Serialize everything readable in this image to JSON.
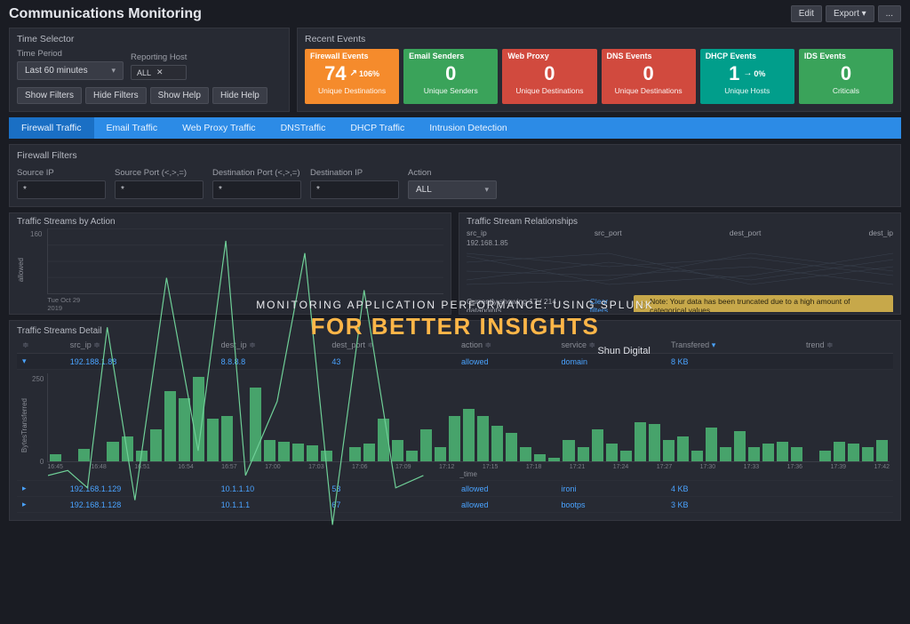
{
  "header": {
    "title": "Communications Monitoring",
    "edit": "Edit",
    "export": "Export ▾",
    "more": "..."
  },
  "time_selector": {
    "panel_label": "Time Selector",
    "time_period_label": "Time Period",
    "time_period_value": "Last 60 minutes",
    "reporting_host_label": "Reporting Host",
    "reporting_host_value": "ALL",
    "buttons": {
      "show_filters": "Show Filters",
      "hide_filters": "Hide Filters",
      "show_help": "Show Help",
      "hide_help": "Hide Help"
    }
  },
  "recent_events": {
    "panel_label": "Recent Events",
    "cards": [
      {
        "title": "Firewall Events",
        "value": "74",
        "badge": "106%",
        "arrow": "up",
        "sub": "Unique Destinations",
        "color": "c-orange"
      },
      {
        "title": "Email Senders",
        "value": "0",
        "badge": "",
        "arrow": "",
        "sub": "Unique Senders",
        "color": "c-green"
      },
      {
        "title": "Web Proxy",
        "value": "0",
        "badge": "",
        "arrow": "",
        "sub": "Unique Destinations",
        "color": "c-red"
      },
      {
        "title": "DNS Events",
        "value": "0",
        "badge": "",
        "arrow": "",
        "sub": "Unique Destinations",
        "color": "c-red"
      },
      {
        "title": "DHCP Events",
        "value": "1",
        "badge": "0%",
        "arrow": "right",
        "sub": "Unique Hosts",
        "color": "c-teal"
      },
      {
        "title": "IDS Events",
        "value": "0",
        "badge": "",
        "arrow": "",
        "sub": "Criticals",
        "color": "c-green"
      }
    ]
  },
  "tabs": [
    "Firewall Traffic",
    "Email Traffic",
    "Web Proxy Traffic",
    "DNSTraffic",
    "DHCP Traffic",
    "Intrusion Detection"
  ],
  "active_tab": 0,
  "firewall_filters": {
    "label": "Firewall Filters",
    "fields": [
      {
        "label": "Source IP",
        "value": "*"
      },
      {
        "label": "Source Port (<,>,=)",
        "value": "*"
      },
      {
        "label": "Destination Port (<,>,=)",
        "value": "*"
      },
      {
        "label": "Destination IP",
        "value": "*"
      }
    ],
    "action_label": "Action",
    "action_value": "ALL"
  },
  "streams_by_action": {
    "title": "Traffic Streams by Action",
    "ylabel": "allowed",
    "ymax": "160",
    "ymin": "",
    "xticks": [
      "Tue Oct 29",
      "2019"
    ],
    "chart_data": {
      "type": "line",
      "series": [
        {
          "name": "allowed",
          "points": [
            [
              0,
              60
            ],
            [
              5,
              62
            ],
            [
              10,
              55
            ],
            [
              15,
              120
            ],
            [
              22,
              50
            ],
            [
              30,
              140
            ],
            [
              38,
              70
            ],
            [
              45,
              155
            ],
            [
              50,
              60
            ],
            [
              58,
              90
            ],
            [
              65,
              150
            ],
            [
              72,
              40
            ],
            [
              80,
              135
            ],
            [
              88,
              55
            ],
            [
              95,
              60
            ]
          ]
        }
      ],
      "ylim": [
        0,
        160
      ]
    }
  },
  "stream_relationships": {
    "title": "Traffic Stream Relationships",
    "headers": [
      "src_ip",
      "src_port",
      "dest_port",
      "dest_ip"
    ],
    "sample_ip": "192.168.1.85",
    "footer_text": "Currently showing 17 / 214 datapoints",
    "clear_filters": "Clear filters",
    "note": "Note: Your data has been truncated due to a high amount of categorical values."
  },
  "detail": {
    "title": "Traffic Streams Detail",
    "columns": [
      "",
      "src_ip",
      "dest_ip",
      "dest_port",
      "action",
      "service",
      "Transfered",
      "trend"
    ],
    "sort_col": 6,
    "expanded_row": {
      "src_ip": "192.188.1.88",
      "dest_ip": "8.8.8.8",
      "dest_port": "43",
      "action": "allowed",
      "service": "domain",
      "transfered": "8 KB"
    },
    "embed_ylabel": "BytesTransferred",
    "embed_xlabel": "_time",
    "embed_ymax": "250",
    "embed_ymin": "0",
    "embed_xticks": [
      "16:45",
      "16:48",
      "16:51",
      "16:54",
      "16:57",
      "17:00",
      "17:03",
      "17:06",
      "17:09",
      "17:12",
      "17:15",
      "17:18",
      "17:21",
      "17:24",
      "17:27",
      "17:30",
      "17:33",
      "17:36",
      "17:39",
      "17:42"
    ],
    "chart_data": {
      "type": "bar",
      "x": [
        "16:45",
        "16:46",
        "16:47",
        "16:48",
        "16:49",
        "16:50",
        "16:51",
        "16:52",
        "16:53",
        "16:54",
        "16:55",
        "16:56",
        "16:57",
        "16:58",
        "16:59",
        "17:00",
        "17:01",
        "17:02",
        "17:03",
        "17:04",
        "17:05",
        "17:06",
        "17:07",
        "17:08",
        "17:09",
        "17:10",
        "17:11",
        "17:12",
        "17:13",
        "17:14",
        "17:15",
        "17:16",
        "17:17",
        "17:18",
        "17:19",
        "17:20",
        "17:21",
        "17:22",
        "17:23",
        "17:24",
        "17:25",
        "17:26",
        "17:27",
        "17:28",
        "17:29",
        "17:30",
        "17:31",
        "17:32",
        "17:33",
        "17:34",
        "17:35",
        "17:36",
        "17:37",
        "17:38",
        "17:39",
        "17:40",
        "17:41",
        "17:42",
        "17:43"
      ],
      "values": [
        20,
        0,
        35,
        0,
        55,
        70,
        30,
        90,
        200,
        180,
        240,
        120,
        130,
        0,
        210,
        60,
        55,
        50,
        45,
        30,
        0,
        40,
        50,
        120,
        60,
        30,
        90,
        40,
        130,
        150,
        130,
        100,
        80,
        40,
        20,
        10,
        60,
        40,
        90,
        50,
        30,
        110,
        105,
        60,
        70,
        30,
        95,
        40,
        85,
        40,
        50,
        55,
        40,
        0,
        30,
        55,
        50,
        40,
        60
      ],
      "ylabel": "BytesTransferred",
      "xlabel": "_time",
      "ylim": [
        0,
        250
      ]
    },
    "other_rows": [
      {
        "src_ip": "192.168.1.129",
        "dest_ip": "10.1.1.10",
        "dest_port": "53",
        "action": "allowed",
        "service": "ironi",
        "transfered": "4 KB"
      },
      {
        "src_ip": "192.168.1.128",
        "dest_ip": "10.1.1.1",
        "dest_port": "67",
        "action": "allowed",
        "service": "bootps",
        "transfered": "3 KB"
      }
    ]
  },
  "overlay": {
    "line1": "MONITORING APPLICATION PERFORMANCE: USING SPLUNK",
    "line2": "FOR BETTER INSIGHTS",
    "brand": "Shun Digital"
  }
}
